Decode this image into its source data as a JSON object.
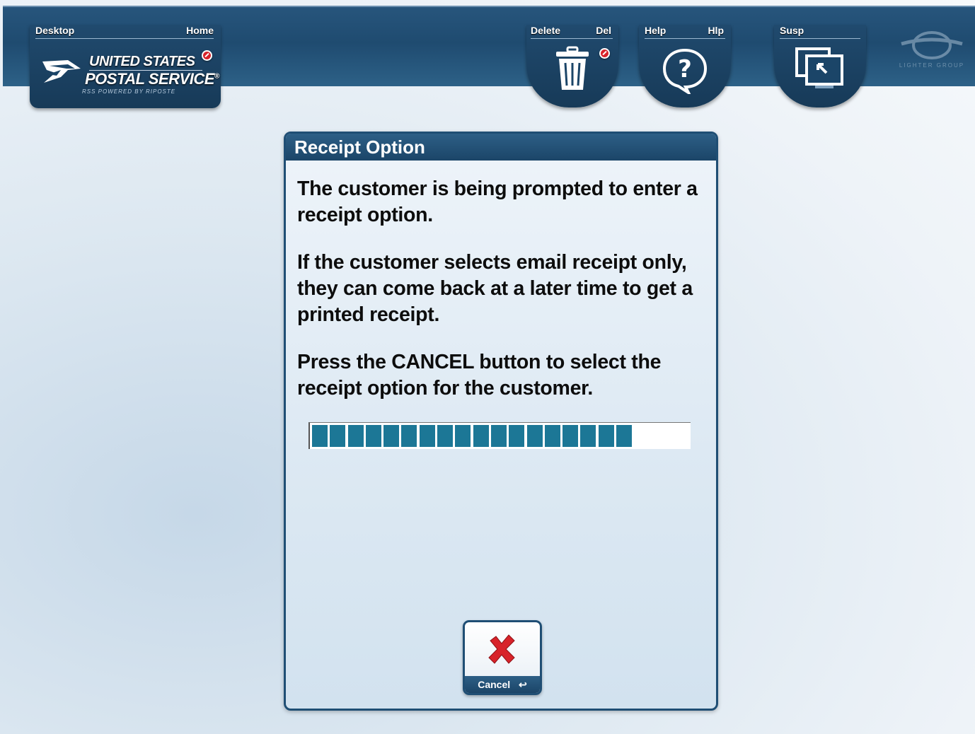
{
  "toolbar": {
    "desktop_label": "Desktop",
    "home_label": "Home",
    "logo": {
      "line1": "UNITED STATES",
      "line2": "POSTAL SERVICE",
      "registered": "®",
      "tagline": "RSS POWERED BY RIPOSTE"
    },
    "delete": {
      "label": "Delete",
      "shortcut": "Del",
      "icon": "trash-icon"
    },
    "help": {
      "label": "Help",
      "shortcut": "Hlp",
      "icon": "help-bubble-icon"
    },
    "suspend": {
      "label": "Susp",
      "icon": "suspend-windows-icon"
    },
    "corner_logo_text": "LIGHTER GROUP"
  },
  "dialog": {
    "title": "Receipt Option",
    "messages": [
      "The customer is being prompted to enter a receipt option.",
      "If the customer selects email receipt only, they can come back at a later time to get a printed receipt.",
      "Press the CANCEL button to select the receipt option for the customer."
    ],
    "progress": {
      "filled_segments": 18,
      "fraction": 0.85
    },
    "cancel_button": {
      "label": "Cancel",
      "key_glyph": "↩",
      "icon": "cancel-x-icon"
    }
  },
  "colors": {
    "toolbar_blue": "#1f4b70",
    "dialog_border": "#1f4e74",
    "progress_fill": "#1c7796",
    "cancel_x_red": "#d8232a"
  }
}
